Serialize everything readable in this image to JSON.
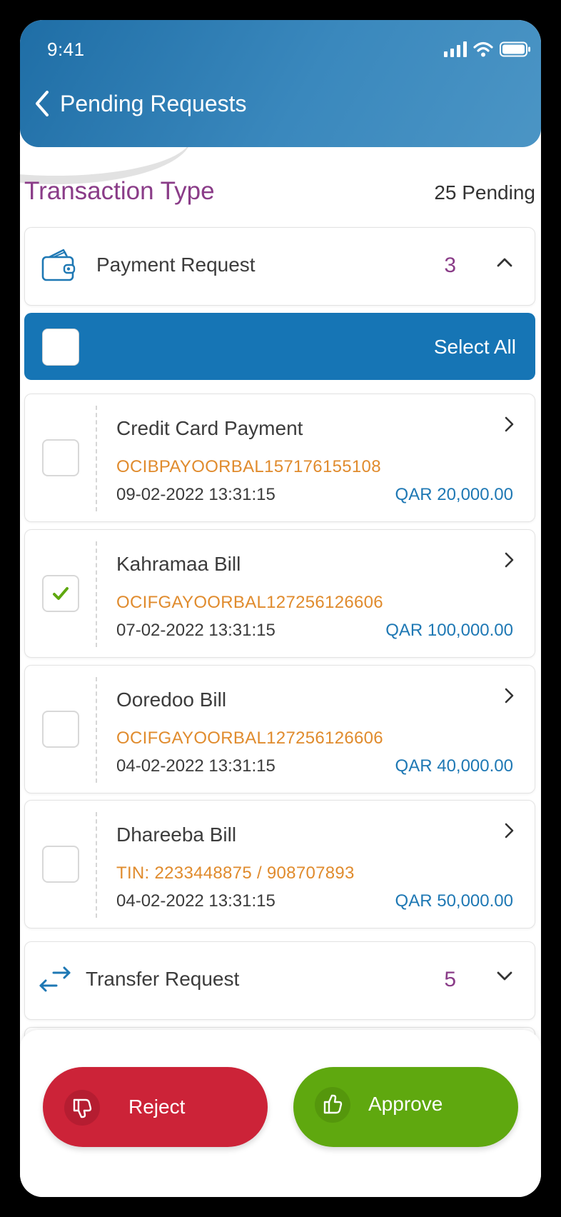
{
  "status_bar": {
    "time": "9:41"
  },
  "header": {
    "title": "Pending Requests"
  },
  "section": {
    "title": "Transaction Type",
    "pending_count": "25 Pending"
  },
  "payment_group": {
    "label": "Payment Request",
    "count": "3",
    "icon": "wallet-icon",
    "expanded": true
  },
  "select_all": {
    "label": "Select All",
    "checked": false
  },
  "transactions": [
    {
      "title": "Credit Card Payment",
      "ref": "OCIBPAYOORBAL157176155108",
      "date": "09-02-2022  13:31:15",
      "amount": "QAR 20,000.00",
      "checked": false
    },
    {
      "title": "Kahramaa Bill",
      "ref": "OCIFGAYOORBAL127256126606",
      "date": "07-02-2022  13:31:15",
      "amount": "QAR 100,000.00",
      "checked": true
    },
    {
      "title": "Ooredoo Bill",
      "ref": "OCIFGAYOORBAL127256126606",
      "date": "04-02-2022  13:31:15",
      "amount": "QAR 40,000.00",
      "checked": false
    },
    {
      "title": "Dhareeba Bill",
      "ref": "TIN: 2233448875 /  908707893",
      "date": "04-02-2022  13:31:15",
      "amount": "QAR 50,000.00",
      "checked": false
    }
  ],
  "transfer_group": {
    "label": "Transfer Request",
    "count": "5",
    "icon": "transfer-arrows-icon",
    "expanded": false
  },
  "actions": {
    "reject_label": "Reject",
    "approve_label": "Approve"
  },
  "colors": {
    "header": "#2e7db4",
    "accent_purple": "#8a3c88",
    "ref_orange": "#e08b2d",
    "amount_blue": "#1e78b4",
    "select_all_bar": "#1675b5",
    "reject": "#cc2338",
    "approve": "#5fa80f",
    "check_green": "#5fa80f"
  }
}
